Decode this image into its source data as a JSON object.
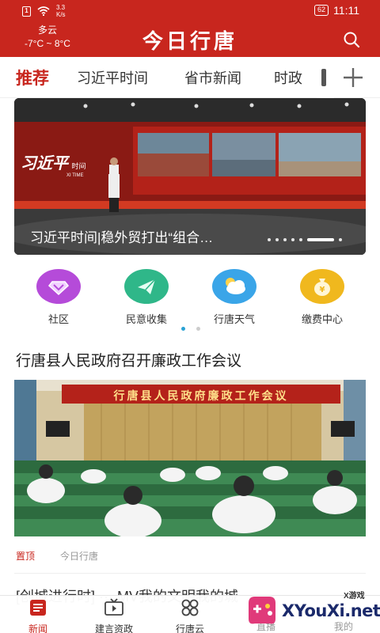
{
  "status_bar": {
    "sim_glyph": "1",
    "speed_value": "3.3",
    "speed_unit": "K/s",
    "battery": "62",
    "time": "11:11"
  },
  "header": {
    "weather_desc": "多云",
    "weather_range": "-7°C ~ 8°C",
    "app_title": "今日行唐",
    "search_icon": "search-icon"
  },
  "tabs": [
    {
      "label": "推荐",
      "active": true
    },
    {
      "label": "习近平时间",
      "active": false
    },
    {
      "label": "省市新闻",
      "active": false
    },
    {
      "label": "时政",
      "active": false
    }
  ],
  "banner": {
    "caption": "习近平时间|稳外贸打出“组合…",
    "screen_logo": "习近平",
    "screen_logo_sub": "时间",
    "screen_logo_en": "XI TIME",
    "slide_count": 7,
    "active_slide": 5
  },
  "quick_links": [
    {
      "label": "社区",
      "icon": "heart-diamond-icon",
      "color": "#b54bd9"
    },
    {
      "label": "民意收集",
      "icon": "send-icon",
      "color": "#2fb789"
    },
    {
      "label": "行唐天气",
      "icon": "weather-cloud-icon",
      "color": "#3aa5e8"
    },
    {
      "label": "缴费中心",
      "icon": "money-bag-icon",
      "color": "#f0b81e"
    }
  ],
  "quick_pages": 2,
  "article": {
    "title": "行唐县人民政府召开廉政工作会议",
    "image_banner_text": "行唐县人民政府廉政工作会议",
    "tag": "置顶",
    "source": "今日行唐"
  },
  "next_article": {
    "title": "[创城进行时] ··· MV我的文明我的城"
  },
  "bottom_nav": [
    {
      "label": "新闻",
      "icon": "news-icon",
      "active": true
    },
    {
      "label": "建言资政",
      "icon": "tv-icon",
      "active": false
    },
    {
      "label": "行唐云",
      "icon": "grid-icon",
      "active": false
    }
  ],
  "bottom_nav_hidden": [
    "直播",
    "我的"
  ],
  "watermark": {
    "small": "X游戏",
    "main": "XYouXi.net"
  },
  "colors": {
    "brand_red": "#c8261e",
    "indicator_blue": "#2aa2d4"
  }
}
